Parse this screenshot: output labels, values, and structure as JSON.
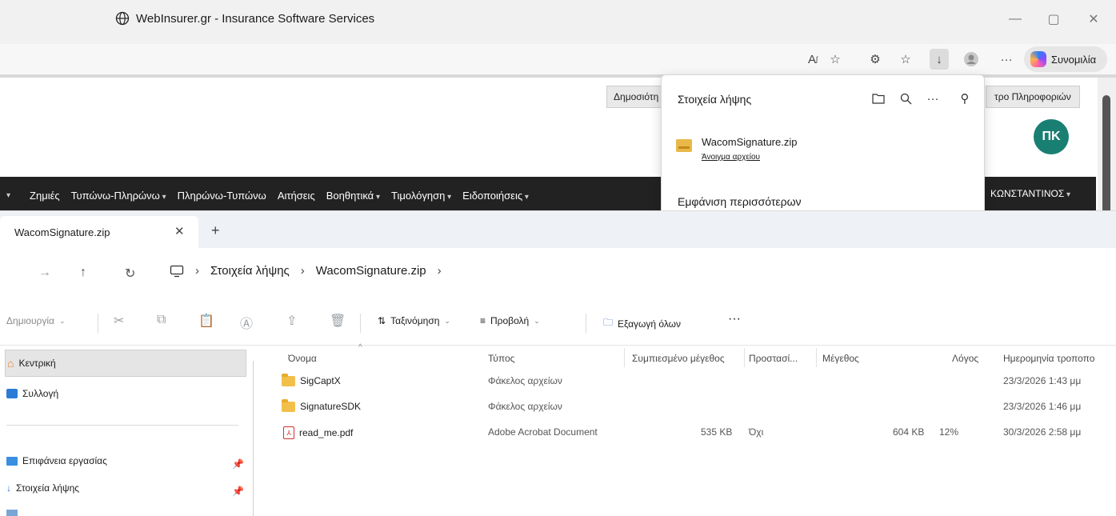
{
  "browser": {
    "window_title": "WebInsurer.gr - Insurance Software Services",
    "copilot_label": "Συνομιλία"
  },
  "webpage": {
    "top_buttons": [
      "Δημοσιότη",
      "τρο Πληροφοριών"
    ],
    "avatar_initials": "ΠΚ",
    "menu": [
      "Ζημιές",
      "Τυπώνω-Πληρώνω",
      "Πληρώνω-Τυπώνω",
      "Αιτήσεις",
      "Βοηθητικά",
      "Τιμολόγηση",
      "Ειδοποιήσεις"
    ],
    "user_menu": "ΚΩΝΣΤΑΝΤΙΝΟΣ"
  },
  "downloads": {
    "title": "Στοιχεία λήψης",
    "file_name": "WacomSignature.zip",
    "open_file": "Άνοιγμα αρχείου",
    "show_more": "Εμφάνιση περισσότερων"
  },
  "explorer": {
    "tab_title": "WacomSignature.zip",
    "breadcrumb": [
      "Στοιχεία λήψης",
      "WacomSignature.zip"
    ],
    "commands": {
      "new": "Δημιουργία",
      "sort": "Ταξινόμηση",
      "view": "Προβολή",
      "extract_all": "Εξαγωγή όλων"
    },
    "sidebar": {
      "home": "Κεντρική",
      "gallery": "Συλλογή",
      "desktop": "Επιφάνεια εργασίας",
      "downloads": "Στοιχεία λήψης"
    },
    "columns": [
      "Όνομα",
      "Τύπος",
      "Συμπιεσμένο μέγεθος",
      "Προστασί...",
      "Μέγεθος",
      "Λόγος",
      "Ημερομηνία τροποπο"
    ],
    "files": [
      {
        "icon": "folder-icon",
        "name": "SigCaptX",
        "type": "Φάκελος αρχείων",
        "compressed": "",
        "protected": "",
        "size": "",
        "ratio": "",
        "date": "23/3/2026 1:43 μμ"
      },
      {
        "icon": "folder-icon",
        "name": "SignatureSDK",
        "type": "Φάκελος αρχείων",
        "compressed": "",
        "protected": "",
        "size": "",
        "ratio": "",
        "date": "23/3/2026 1:46 μμ"
      },
      {
        "icon": "pdf-icon",
        "name": "read_me.pdf",
        "type": "Adobe Acrobat Document",
        "compressed": "535 KB",
        "protected": "Όχι",
        "size": "604 KB",
        "ratio": "12%",
        "date": "30/3/2026 2:58 μμ"
      }
    ]
  }
}
